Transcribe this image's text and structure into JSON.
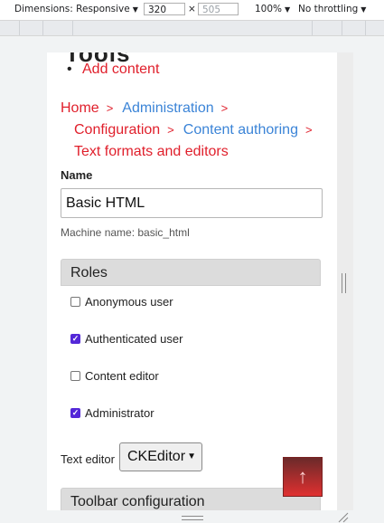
{
  "devtools": {
    "dimensions_label": "Dimensions: Responsive",
    "width_value": "320",
    "times": "×",
    "height_placeholder": "505",
    "zoom": "100%",
    "throttling": "No throttling",
    "dropdown_icon": "▼"
  },
  "page": {
    "cut_title": "Tools",
    "add_content": "Add content",
    "breadcrumb": {
      "home": "Home",
      "administration": "Administration",
      "configuration": "Configuration",
      "content_authoring": "Content authoring",
      "text_formats": "Text formats and editors",
      "separator": ">"
    },
    "name_label": "Name",
    "name_value": "Basic HTML",
    "machine_name": "Machine name: basic_html",
    "roles_heading": "Roles",
    "roles": [
      {
        "label": "Anonymous user",
        "checked": false
      },
      {
        "label": "Authenticated user",
        "checked": true
      },
      {
        "label": "Content editor",
        "checked": false
      },
      {
        "label": "Administrator",
        "checked": true
      }
    ],
    "text_editor_label": "Text editor",
    "text_editor_value": "CKEditor",
    "toolbar_heading": "Toolbar configuration",
    "scroll_top_icon": "↑"
  },
  "colors": {
    "link_red": "#e01f2b",
    "link_blue": "#3b84d7",
    "checkbox_checked": "#5428d8"
  }
}
